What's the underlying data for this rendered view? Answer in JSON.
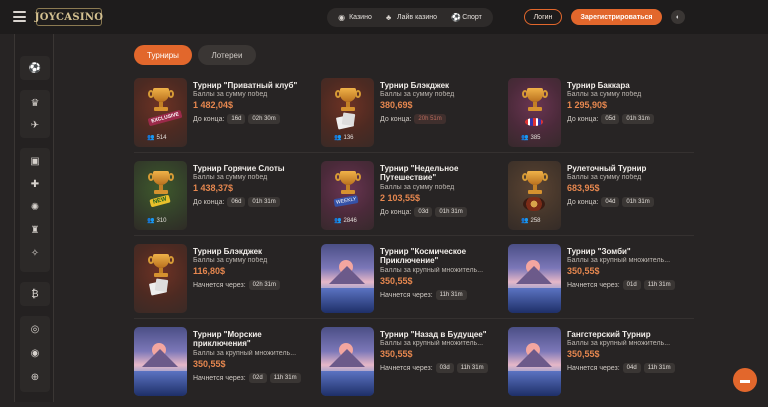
{
  "header": {
    "logo": "JOYCASINO",
    "nav": [
      {
        "label": "Казино",
        "icon": "slots-icon"
      },
      {
        "label": "Лайв казино",
        "icon": "live-casino-icon"
      },
      {
        "label": "Спорт",
        "icon": "sport-ball-icon"
      }
    ],
    "login_label": "Логин",
    "register_label": "Зарегистрироваться"
  },
  "tabs": {
    "active": "Турниры",
    "inactive": "Лотереи"
  },
  "tournaments": [
    {
      "title": "Турнир \"Приватный клуб\"",
      "subtitle": "Баллы за сумму побед",
      "amount": "1 482,04$",
      "timer_label": "До конца:",
      "days": "16d",
      "time": "02h 30m",
      "players": "514",
      "theme": "exclusive"
    },
    {
      "title": "Турнир Блэкджек",
      "subtitle": "Баллы за сумму побед",
      "amount": "380,69$",
      "timer_label": "До конца:",
      "days": "",
      "time": "20h 51m",
      "players": "136",
      "theme": "cards"
    },
    {
      "title": "Турнир Баккара",
      "subtitle": "Баллы за сумму побед",
      "amount": "1 295,90$",
      "timer_label": "До конца:",
      "days": "05d",
      "time": "01h 31m",
      "players": "385",
      "theme": "chips"
    },
    {
      "title": "Турнир Горячие Слоты",
      "subtitle": "Баллы за сумму побед",
      "amount": "1 438,37$",
      "timer_label": "До конца:",
      "days": "06d",
      "time": "01h 31m",
      "players": "310",
      "theme": "new"
    },
    {
      "title": "Турнир \"Недельное Путешествие\"",
      "subtitle": "Баллы за сумму побед",
      "amount": "2 103,55$",
      "timer_label": "До конца:",
      "days": "03d",
      "time": "01h 31m",
      "players": "2846",
      "theme": "sticker"
    },
    {
      "title": "Рулеточный Турнир",
      "subtitle": "Баллы за сумму побед",
      "amount": "683,95$",
      "timer_label": "До конца:",
      "days": "04d",
      "time": "01h 31m",
      "players": "258",
      "theme": "wheel"
    },
    {
      "title": "Турнир Блэкджек",
      "subtitle": "Баллы за сумму побед",
      "amount": "116,80$",
      "timer_label": "Начнется через:",
      "days": "",
      "time": "02h 31m",
      "players": "",
      "theme": "cards"
    },
    {
      "title": "Турнир \"Космическое Приключение\"",
      "subtitle": "Баллы за крупный множитель...",
      "amount": "350,55$",
      "timer_label": "Начнется через:",
      "days": "",
      "time": "11h 31m",
      "players": "",
      "theme": "scene"
    },
    {
      "title": "Турнир \"Зомби\"",
      "subtitle": "Баллы за крупный множитель...",
      "amount": "350,55$",
      "timer_label": "Начнется через:",
      "days": "01d",
      "time": "11h 31m",
      "players": "",
      "theme": "scene"
    },
    {
      "title": "Турнир \"Морские приключения\"",
      "subtitle": "Баллы за крупный множитель...",
      "amount": "350,55$",
      "timer_label": "Начнется через:",
      "days": "02d",
      "time": "11h 31m",
      "players": "",
      "theme": "scene"
    },
    {
      "title": "Турнир \"Назад в Будущее\"",
      "subtitle": "Баллы за крупный множитель...",
      "amount": "350,55$",
      "timer_label": "Начнется через:",
      "days": "03d",
      "time": "11h 31m",
      "players": "",
      "theme": "scene"
    },
    {
      "title": "Гангстерский Турнир",
      "subtitle": "Баллы за крупный множитель...",
      "amount": "350,55$",
      "timer_label": "Начнется через:",
      "days": "04d",
      "time": "11h 31m",
      "players": "",
      "theme": "scene"
    }
  ],
  "thumb_labels": {
    "exclusive": "EXCLUSIVE",
    "new": "NEW",
    "sticker": "WEEKLY"
  },
  "colors": {
    "accent": "#e2672c",
    "background": "#272424",
    "amount": "#e6874f"
  }
}
